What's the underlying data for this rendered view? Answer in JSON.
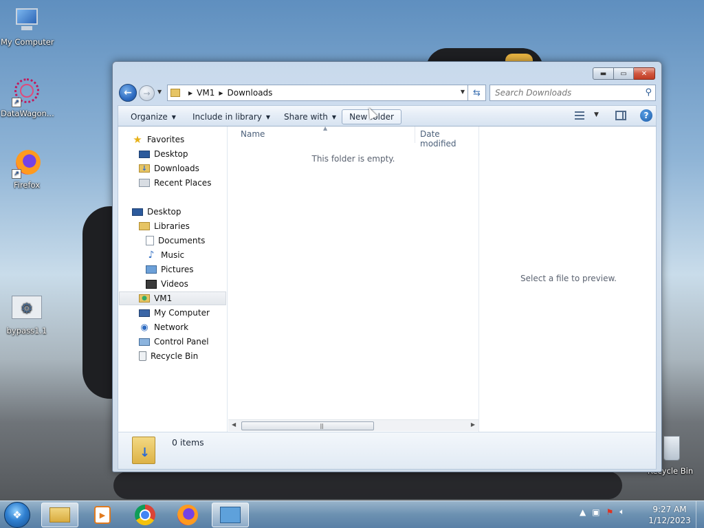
{
  "desktop": {
    "icons": [
      {
        "label": "My Computer"
      },
      {
        "label": "DataWagon..."
      },
      {
        "label": "Firefox"
      },
      {
        "label": "bypass1.1"
      },
      {
        "label": "Recycle Bin"
      }
    ]
  },
  "window": {
    "caption_buttons": {
      "minimize": "▬",
      "maximize": "▭",
      "close": "✕"
    },
    "address": {
      "crumbs": [
        "VM1",
        "Downloads"
      ]
    },
    "search": {
      "placeholder": "Search Downloads"
    },
    "toolbar": {
      "organize": "Organize",
      "include_in_library": "Include in library",
      "share_with": "Share with",
      "new_folder": "New folder"
    },
    "nav": {
      "favorites": "Favorites",
      "desktop_fav": "Desktop",
      "downloads": "Downloads",
      "recent_places": "Recent Places",
      "desktop": "Desktop",
      "libraries": "Libraries",
      "documents": "Documents",
      "music": "Music",
      "pictures": "Pictures",
      "videos": "Videos",
      "vm1": "VM1",
      "my_computer": "My Computer",
      "network": "Network",
      "control_panel": "Control Panel",
      "recycle_bin": "Recycle Bin"
    },
    "columns": {
      "name": "Name",
      "date_modified": "Date modified"
    },
    "empty_message": "This folder is empty.",
    "preview_message": "Select a file to preview.",
    "details": {
      "item_count": "0 items"
    }
  },
  "taskbar": {
    "clock": {
      "time": "9:27 AM",
      "date": "1/12/2023"
    }
  }
}
